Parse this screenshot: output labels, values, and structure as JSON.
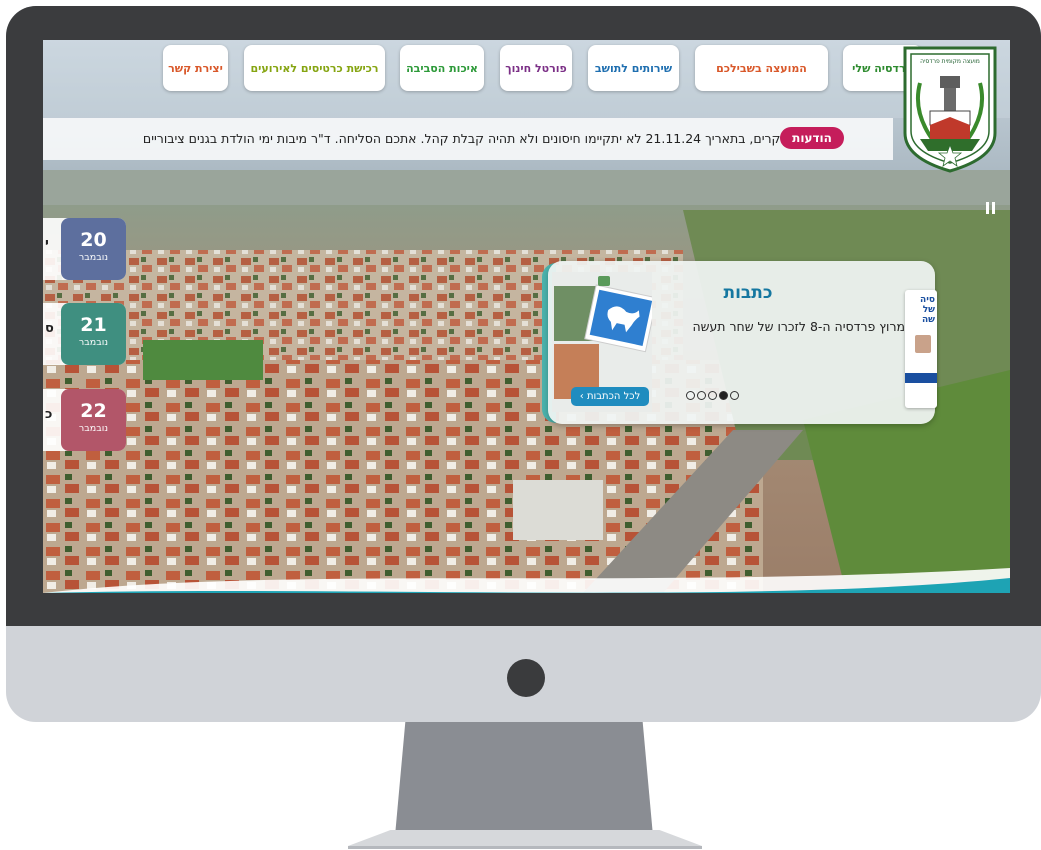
{
  "nav": {
    "items": [
      {
        "label": "פרדסיה שלי",
        "color": "#2e8b2f"
      },
      {
        "label": "המועצה בשבילכם",
        "color": "#d9582a"
      },
      {
        "label": "שירותים לתושב",
        "color": "#1f6fb0"
      },
      {
        "label": "פורטל חינוך",
        "color": "#7b2f86"
      },
      {
        "label": "איכות הסביבה",
        "color": "#2e9a3a"
      },
      {
        "label": "רכישת כרטיסים לאירועים",
        "color": "#86a512"
      },
      {
        "label": "יצירת קשר",
        "color": "#d9582a"
      }
    ]
  },
  "logo": {
    "top_text": "מועצה מקומית פרדסיה"
  },
  "ticker": {
    "badge": "הודעות",
    "text": "תושבים יקרים, בתאריך 21.11.24 לא יתקיימו חיסונים ולא תהיה קבלת קהל. אתכם הסליחה. ד\"ר  ",
    "text2": "מיבות ימי הולדת בגנים ציבוריים",
    "badge_color": "#c51d5b"
  },
  "events": [
    {
      "day": "20",
      "month": "נובמבר",
      "color": "#5d6f9e",
      "edge": "י"
    },
    {
      "day": "21",
      "month": "נובמבר",
      "color": "#3f8f80",
      "edge": "ס"
    },
    {
      "day": "22",
      "month": "נובמבר",
      "color": "#b25669",
      "edge": "כ"
    }
  ],
  "featured": {
    "title": "כתבות",
    "text": "מרוץ פרדסיה ה-8 לזכרו של שחר תעשה",
    "link": "לכל הכתבות ›",
    "title_color": "#1577a0",
    "slides_total": 5,
    "slide_active": 2,
    "side_text": "סיה של שה"
  },
  "icons": {
    "pause": "pause-icon",
    "next": "chevron-right-icon"
  }
}
